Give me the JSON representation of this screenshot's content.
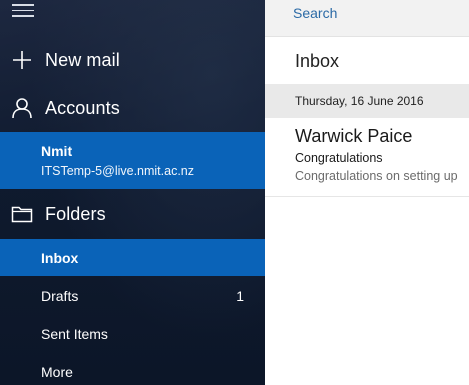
{
  "nav": {
    "new_mail_label": "New mail",
    "accounts_label": "Accounts",
    "folders_label": "Folders",
    "more_label": "More"
  },
  "account": {
    "name": "Nmit",
    "email": "ITSTemp-5@live.nmit.ac.nz"
  },
  "folders": [
    {
      "label": "Inbox",
      "count": "",
      "selected": true
    },
    {
      "label": "Drafts",
      "count": "1",
      "selected": false
    },
    {
      "label": "Sent Items",
      "count": "",
      "selected": false
    }
  ],
  "search": {
    "placeholder": "Search"
  },
  "list": {
    "title": "Inbox",
    "date_header": "Thursday, 16 June 2016",
    "messages": [
      {
        "sender": "Warwick Paice",
        "subject": "Congratulations",
        "preview": "Congratulations on setting up"
      }
    ]
  },
  "colors": {
    "accent": "#0a63b8",
    "nav_background": "#111c31",
    "search_text": "#2b6aa6"
  }
}
